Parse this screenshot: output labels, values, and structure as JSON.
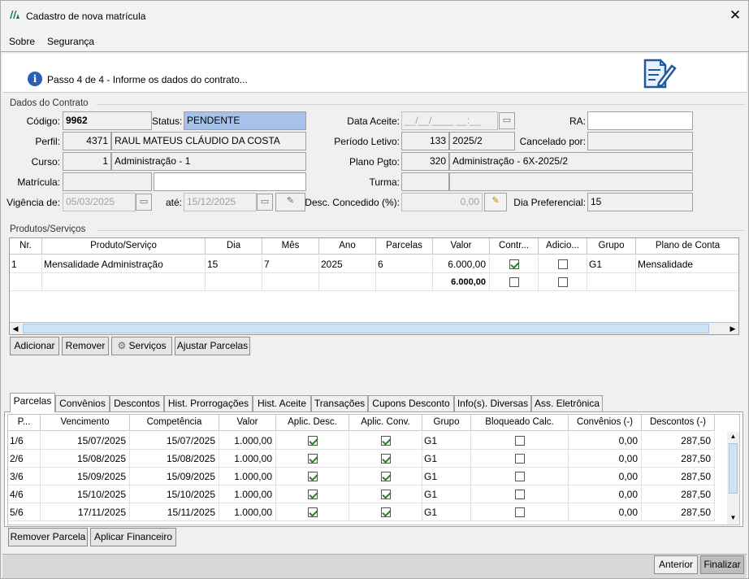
{
  "window": {
    "title": "Cadastro de nova matrícula",
    "close_label": "✕"
  },
  "menu": {
    "sobre": "Sobre",
    "seguranca": "Segurança"
  },
  "banner": {
    "step_text": "Passo 4 de 4 - Informe os dados do contrato..."
  },
  "dados_contrato": {
    "group_title": "Dados do Contrato",
    "codigo_label": "Código:",
    "codigo": "9962",
    "status_label": "Status:",
    "status": "PENDENTE",
    "data_aceite_label": "Data Aceite:",
    "data_aceite_mask": "__/__/____ __:__",
    "ra_label": "RA:",
    "ra": "",
    "perfil_label": "Perfil:",
    "perfil_code": "4371",
    "perfil_name": "RAUL MATEUS CLÁUDIO DA COSTA",
    "periodo_label": "Período Letivo:",
    "periodo_code": "133",
    "periodo_name": "2025/2",
    "cancelado_label": "Cancelado por:",
    "cancelado": "",
    "curso_label": "Curso:",
    "curso_code": "1",
    "curso_name": "Administração - 1",
    "plano_label": "Plano Pgto:",
    "plano_code": "320",
    "plano_name": "Administração - 6X-2025/2",
    "matricula_label": "Matrícula:",
    "matricula": "",
    "matricula2": "",
    "turma_label": "Turma:",
    "turma_code": "",
    "turma_name": "",
    "vigencia_label": "Vigência de:",
    "vigencia_de": "05/03/2025",
    "ate_label": "até:",
    "vigencia_ate": "15/12/2025",
    "desc_label": "Desc. Concedido (%):",
    "desc_value": "0,00",
    "dia_pref_label": "Dia Preferencial:",
    "dia_pref": "15"
  },
  "produtos": {
    "group_title": "Produtos/Serviços",
    "headers": [
      "Nr.",
      "Produto/Serviço",
      "Dia",
      "Mês",
      "Ano",
      "Parcelas",
      "Valor",
      "Contr...",
      "Adicio...",
      "Grupo",
      "Plano de Conta"
    ],
    "rows": [
      {
        "nr": "1",
        "produto": "Mensalidade Administração",
        "dia": "15",
        "mes": "7",
        "ano": "2025",
        "parcelas": "6",
        "valor": "6.000,00",
        "contr": true,
        "adicio": false,
        "grupo": "G1",
        "plano": "Mensalidade"
      }
    ],
    "total_valor": "6.000,00",
    "total_contr": false,
    "total_adicio": false
  },
  "produtos_buttons": {
    "adicionar": "Adicionar",
    "remover": "Remover",
    "servicos": "Serviços",
    "ajustar": "Ajustar Parcelas"
  },
  "tabs": [
    "Parcelas",
    "Convênios",
    "Descontos",
    "Hist. Prorrogações",
    "Hist. Aceite",
    "Transações",
    "Cupons Desconto",
    "Info(s). Diversas",
    "Ass. Eletrônica"
  ],
  "parcelas": {
    "headers": [
      "P...",
      "Vencimento",
      "Competência",
      "Valor",
      "Aplic. Desc.",
      "Aplic. Conv.",
      "Grupo",
      "Bloqueado Calc.",
      "Convênios (-)",
      "Descontos (-)"
    ],
    "rows": [
      {
        "p": "1/6",
        "venc": "15/07/2025",
        "comp": "15/07/2025",
        "valor": "1.000,00",
        "desc": true,
        "conv": true,
        "grupo": "G1",
        "bloq": false,
        "convenios": "0,00",
        "descontos": "287,50"
      },
      {
        "p": "2/6",
        "venc": "15/08/2025",
        "comp": "15/08/2025",
        "valor": "1.000,00",
        "desc": true,
        "conv": true,
        "grupo": "G1",
        "bloq": false,
        "convenios": "0,00",
        "descontos": "287,50"
      },
      {
        "p": "3/6",
        "venc": "15/09/2025",
        "comp": "15/09/2025",
        "valor": "1.000,00",
        "desc": true,
        "conv": true,
        "grupo": "G1",
        "bloq": false,
        "convenios": "0,00",
        "descontos": "287,50"
      },
      {
        "p": "4/6",
        "venc": "15/10/2025",
        "comp": "15/10/2025",
        "valor": "1.000,00",
        "desc": true,
        "conv": true,
        "grupo": "G1",
        "bloq": false,
        "convenios": "0,00",
        "descontos": "287,50"
      },
      {
        "p": "5/6",
        "venc": "17/11/2025",
        "comp": "15/11/2025",
        "valor": "1.000,00",
        "desc": true,
        "conv": true,
        "grupo": "G1",
        "bloq": false,
        "convenios": "0,00",
        "descontos": "287,50"
      }
    ]
  },
  "parcelas_buttons": {
    "remover": "Remover Parcela",
    "aplicar": "Aplicar Financeiro"
  },
  "footer": {
    "anterior": "Anterior",
    "finalizar": "Finalizar"
  },
  "colors": {
    "status_bg": "#a6c2e8",
    "check_green": "#1a8a1a",
    "info_blue": "#2a5fb8"
  }
}
